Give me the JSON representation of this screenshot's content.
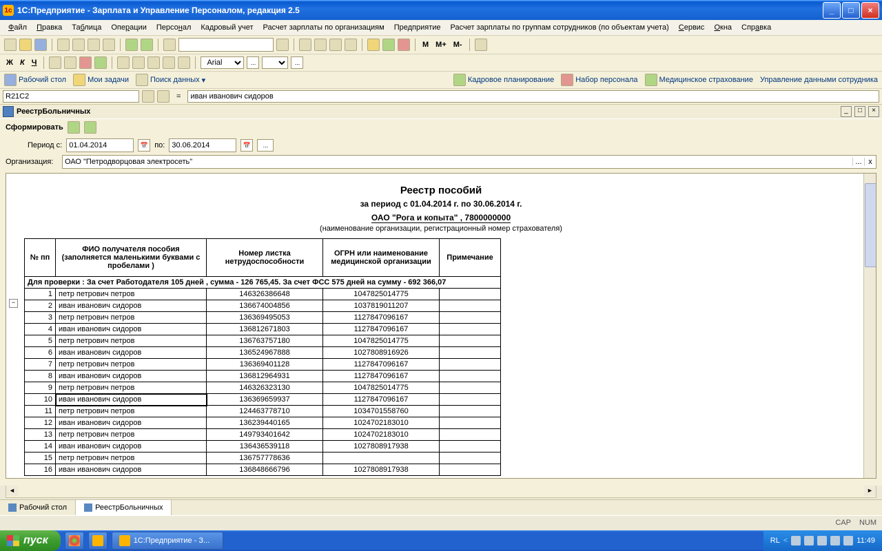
{
  "window": {
    "title": "1С:Предприятие  - Зарплата и Управление Персоналом, редакция 2.5"
  },
  "menu": [
    "Файл",
    "Правка",
    "Таблица",
    "Операции",
    "Персонал",
    "Кадровый учет",
    "Расчет зарплаты по организациям",
    "Предприятие",
    "Расчет зарплаты по группам сотрудников (по объектам учета)",
    "Сервис",
    "Окна",
    "Справка"
  ],
  "font": {
    "name": "Arial",
    "size": "8"
  },
  "formatChars": {
    "bold": "Ж",
    "italic": "К",
    "underline": "Ч"
  },
  "mButtons": {
    "m": "М",
    "mplus": "М+",
    "mminus": "М-"
  },
  "quicklinks": {
    "desktop": "Рабочий стол",
    "tasks": "Мои задачи",
    "search": "Поиск данных",
    "plan": "Кадровое планирование",
    "recruit": "Набор персонала",
    "med": "Медицинское страхование",
    "data": "Управление данными сотрудника"
  },
  "cell": {
    "ref": "R21C2",
    "value": "иван иванович сидоров",
    "eq": "="
  },
  "tab": {
    "title": "РеестрБольничных"
  },
  "form": {
    "generate": "Сформировать",
    "periodFromLabel": "Период с:",
    "periodFrom": "01.04.2014",
    "periodToLabel": "по:",
    "periodTo": "30.06.2014",
    "ellipsis": "...",
    "orgLabel": "Организация:",
    "orgValue": "ОАО \"Петродворцовая электросеть\"",
    "clear": "x"
  },
  "report": {
    "title": "Реестр пособий",
    "period": "за период с 01.04.2014 г. по 30.06.2014 г.",
    "org": "ОАО \"Рога и копыта\" , 7800000000",
    "hint": "(наименование организации, регистрационный номер страхователя)",
    "cols": [
      "№ пп",
      "ФИО  получателя пособия (заполняется маленькими буквами с пробелами )",
      "Номер  листка нетрудоспособности",
      "ОГРН или наименование медицинской организации",
      "Примечание"
    ],
    "check": "Для проверки : За счет Работодателя 105 дней , сумма - 126 765,45.  За счет ФСС 575 дней на сумму - 692 366,07",
    "rows": [
      {
        "n": "1",
        "fio": "петр петрович петров",
        "sheet": "146326386648",
        "ogrn": "1047825014775"
      },
      {
        "n": "2",
        "fio": "иван иванович сидоров",
        "sheet": "136674004856",
        "ogrn": "1037819011207"
      },
      {
        "n": "3",
        "fio": "петр петрович петров",
        "sheet": "136369495053",
        "ogrn": "1127847096167"
      },
      {
        "n": "4",
        "fio": "иван иванович сидоров",
        "sheet": "136812671803",
        "ogrn": "1127847096167"
      },
      {
        "n": "5",
        "fio": "петр петрович петров",
        "sheet": "136763757180",
        "ogrn": "1047825014775"
      },
      {
        "n": "6",
        "fio": "иван иванович сидоров",
        "sheet": "136524967888",
        "ogrn": "1027808916926"
      },
      {
        "n": "7",
        "fio": "петр петрович петров",
        "sheet": "136369401128",
        "ogrn": "1127847096167"
      },
      {
        "n": "8",
        "fio": "иван иванович сидоров",
        "sheet": "136812964931",
        "ogrn": "1127847096167"
      },
      {
        "n": "9",
        "fio": "петр петрович петров",
        "sheet": "146326323130",
        "ogrn": "1047825014775"
      },
      {
        "n": "10",
        "fio": "иван иванович сидоров",
        "sheet": "136369659937",
        "ogrn": "1127847096167"
      },
      {
        "n": "11",
        "fio": "петр петрович петров",
        "sheet": "124463778710",
        "ogrn": "1034701558760"
      },
      {
        "n": "12",
        "fio": "иван иванович сидоров",
        "sheet": "136239440165",
        "ogrn": "1024702183010"
      },
      {
        "n": "13",
        "fio": "петр петрович петров",
        "sheet": "149793401642",
        "ogrn": "1024702183010"
      },
      {
        "n": "14",
        "fio": "иван иванович сидоров",
        "sheet": "136436539118",
        "ogrn": "1027808917938"
      },
      {
        "n": "15",
        "fio": "петр петрович петров",
        "sheet": "136757778636",
        "ogrn": ""
      },
      {
        "n": "16",
        "fio": "иван иванович сидоров",
        "sheet": "136848666796",
        "ogrn": "1027808917938"
      }
    ],
    "collapse": "−"
  },
  "bottomTabs": {
    "desktop": "Рабочий стол",
    "current": "РеестрБольничных"
  },
  "status": {
    "cap": "CAP",
    "num": "NUM"
  },
  "taskbar": {
    "start": "пуск",
    "app": "1С:Предприятие - З...",
    "lang": "RL",
    "time": "11:49"
  }
}
